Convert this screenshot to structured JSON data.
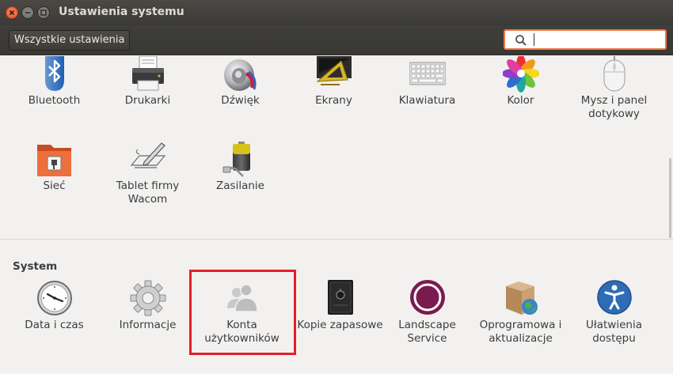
{
  "window": {
    "title": "Ustawienia systemu"
  },
  "toolbar": {
    "all_settings_label": "Wszystkie ustawienia",
    "search_placeholder": "",
    "search_value": ""
  },
  "hardware": {
    "items": [
      {
        "label": "Bluetooth",
        "icon": "bluetooth-icon"
      },
      {
        "label": "Drukarki",
        "icon": "printer-icon"
      },
      {
        "label": "Dźwięk",
        "icon": "speaker-icon"
      },
      {
        "label": "Ekrany",
        "icon": "displays-icon"
      },
      {
        "label": "Klawiatura",
        "icon": "keyboard-icon"
      },
      {
        "label": "Kolor",
        "icon": "color-icon"
      },
      {
        "label": "Mysz i panel dotykowy",
        "icon": "mouse-icon"
      },
      {
        "label": "Sieć",
        "icon": "network-icon"
      },
      {
        "label": "Tablet firmy Wacom",
        "icon": "tablet-icon"
      },
      {
        "label": "Zasilanie",
        "icon": "battery-icon"
      }
    ]
  },
  "system": {
    "title": "System",
    "items": [
      {
        "label": "Data i czas",
        "icon": "clock-icon"
      },
      {
        "label": "Informacje",
        "icon": "gear-icon"
      },
      {
        "label": "Konta użytkowników",
        "icon": "users-icon"
      },
      {
        "label": "Kopie zapasowe",
        "icon": "safe-icon"
      },
      {
        "label": "Landscape Service",
        "icon": "landscape-icon"
      },
      {
        "label": "Oprogramowa i aktualizacje",
        "icon": "software-update-icon"
      },
      {
        "label": "Ułatwienia dostępu",
        "icon": "accessibility-icon"
      }
    ]
  },
  "colors": {
    "accent": "#e95420",
    "highlight": "#e41e26",
    "titlebar": "#3c3b37"
  }
}
